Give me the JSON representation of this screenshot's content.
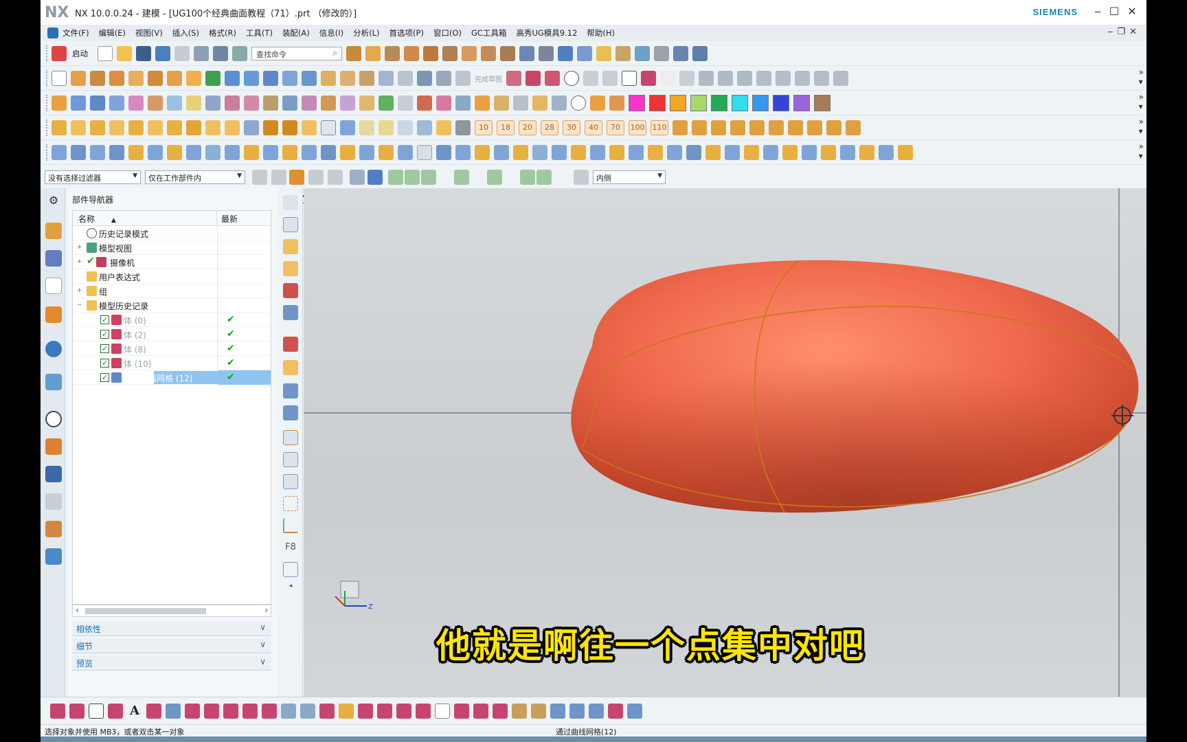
{
  "window": {
    "logo": "NX",
    "title": "NX 10.0.0.24 - 建模 - [UG100个经典曲面教程（71）.prt （修改的）]",
    "brand": "SIEMENS"
  },
  "menubar": {
    "items": [
      "文件(F)",
      "编辑(E)",
      "视图(V)",
      "插入(S)",
      "格式(R)",
      "工具(T)",
      "装配(A)",
      "信息(I)",
      "分析(L)",
      "首选项(P)",
      "窗口(O)",
      "GC工具箱",
      "高秀UG模具9.12",
      "帮助(H)"
    ]
  },
  "toolbar": {
    "start_label": "启动",
    "search_placeholder": "查找命令",
    "sketch_label": "完成草图",
    "number_buttons": [
      "10",
      "18",
      "20",
      "28",
      "30",
      "40",
      "70",
      "100",
      "110"
    ],
    "color_swatches": [
      "#ff33cc",
      "#ee3333",
      "#f5a623",
      "#a8d86a",
      "#22aa55",
      "#33ddee",
      "#3399ee",
      "#3344dd",
      "#9966dd",
      "#a67c52"
    ]
  },
  "filterbar": {
    "type_filter": "没有选择过滤器",
    "scope_filter": "仅在工作部件内",
    "position_filter": "内侧"
  },
  "navigator": {
    "title": "部件导航器",
    "col_name": "名称",
    "col_latest": "最新",
    "rows": [
      {
        "label": "历史记录模式",
        "indent": 0
      },
      {
        "label": "模型视图",
        "indent": 0
      },
      {
        "label": "摄像机",
        "indent": 0
      },
      {
        "label": "用户表达式",
        "indent": 0
      },
      {
        "label": "组",
        "indent": 0
      },
      {
        "label": "模型历史记录",
        "indent": 0
      },
      {
        "label": "体 (0)",
        "indent": 1
      },
      {
        "label": "体 (2)",
        "indent": 1
      },
      {
        "label": "体 (8)",
        "indent": 1
      },
      {
        "label": "体 (10)",
        "indent": 1
      },
      {
        "label": "通过曲线网格 (12)",
        "indent": 1
      }
    ],
    "sections": [
      "相依性",
      "细节",
      "预览"
    ]
  },
  "caption": "他就是啊往一个点集中对吧",
  "status": {
    "left": "选择对象并使用 MB3，或者双击某一对象",
    "middle": "通过曲线网格(12)"
  },
  "colors": {
    "body_fill": "#f06a4c",
    "edge_curve": "#c87818",
    "selection": "#8ec5f0",
    "caption": "#ffe600"
  }
}
